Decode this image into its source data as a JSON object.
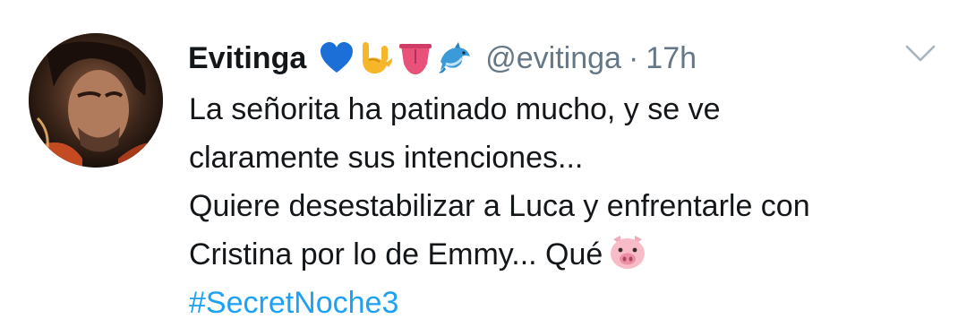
{
  "tweet": {
    "display_name": "Evitinga",
    "name_emojis": [
      "blue-heart",
      "sign-of-horns",
      "tongue",
      "dolphin"
    ],
    "handle": "@evitinga",
    "separator": "·",
    "timestamp": "17h",
    "lines": [
      "La señorita ha patinado mucho, y se ve",
      "claramente sus intenciones...",
      "Quiere desestabilizar a Luca y enfrentarle con",
      "Cristina por lo de Emmy... Qué"
    ],
    "line4_emoji": "pig-face",
    "hashtag": "#SecretNoche3"
  },
  "colors": {
    "text": "#14171a",
    "secondary": "#657786",
    "link": "#1da1f2"
  }
}
